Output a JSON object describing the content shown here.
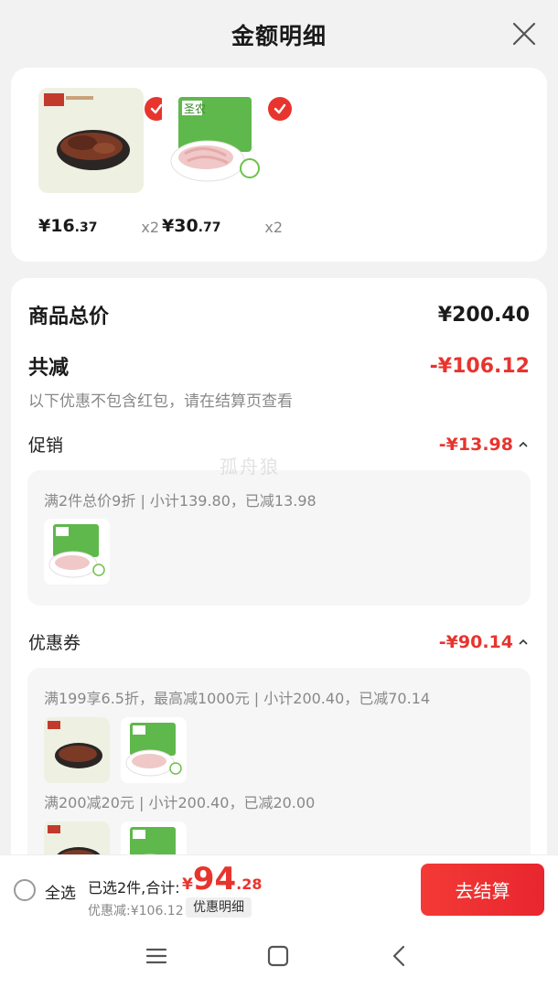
{
  "header": {
    "title": "金额明细"
  },
  "products": [
    {
      "name": "beef",
      "price_int": "¥16",
      "price_dec": ".37",
      "qty": "x2"
    },
    {
      "name": "duck-feet",
      "price_int": "¥30",
      "price_dec": ".77",
      "qty": "x2"
    }
  ],
  "summary": {
    "subtotal_label": "商品总价",
    "subtotal_value": "¥200.40",
    "reduce_label": "共减",
    "reduce_value": "-¥106.12",
    "note": "以下优惠不包含红包，请在结算页查看"
  },
  "promo": {
    "label": "促销",
    "value": "-¥13.98",
    "rule": "满2件总价9折 | 小计139.80，已减13.98"
  },
  "coupon": {
    "label": "优惠券",
    "value": "-¥90.14",
    "rule1": "满199享6.5折，最高减1000元 | 小计200.40，已减70.14",
    "rule2": "满200减20元 | 小计200.40，已减20.00"
  },
  "watermark": "孤舟狼",
  "bottom_bar": {
    "select_all": "全选",
    "selected": "已选2件,合计:",
    "total_currency": "¥",
    "total_int": "94",
    "total_dec": ".28",
    "discount": "优惠减:¥106.12",
    "detail_button": "优惠明细",
    "checkout": "去结算"
  },
  "colors": {
    "accent": "#e8342e",
    "background": "#f2f2f2"
  }
}
